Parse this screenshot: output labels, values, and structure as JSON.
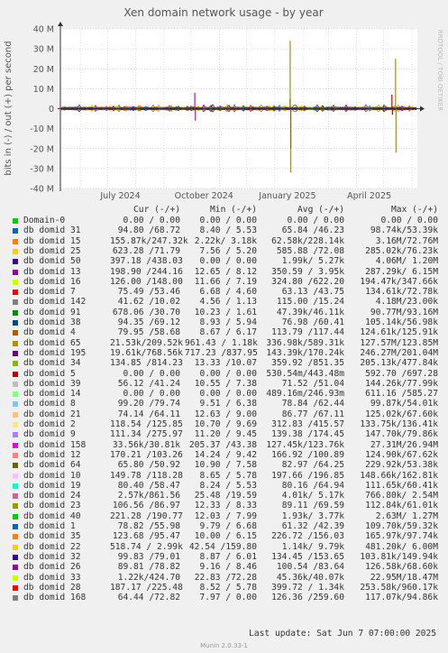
{
  "chart_data": {
    "type": "line",
    "title": "Xen domain network usage - by year",
    "ylabel": "bits in (-) / out (+) per second",
    "ylim": [
      -40000000,
      40000000
    ],
    "y_ticks": [
      "40 M",
      "30 M",
      "20 M",
      "10 M",
      "0",
      "-10 M",
      "-20 M",
      "-30 M",
      "-40 M"
    ],
    "x_ticks": [
      "July 2024",
      "October 2024",
      "January 2025",
      "April 2025"
    ],
    "side_label": "RRDTOOL / TOBI OETIKER",
    "grid": true,
    "spikes": [
      {
        "date": "2024-10-05",
        "out": 8000000,
        "in": -6000000,
        "color": "#cc00cc"
      },
      {
        "date": "2025-01-18",
        "out": 34000000,
        "in": -32000000,
        "color": "#b08c00"
      },
      {
        "date": "2025-01-18",
        "out": 5000000,
        "in": -20000000,
        "color": "#7d6c00"
      },
      {
        "date": "2025-05-14",
        "out": 25000000,
        "in": -22000000,
        "color": "#b08c00"
      },
      {
        "date": "2025-05-10",
        "out": 7000000,
        "in": -3000000,
        "color": "#cc0000"
      }
    ]
  },
  "legend": {
    "headers": {
      "cur": "Cur (-/+)",
      "min": "Min (-/+)",
      "avg": "Avg (-/+)",
      "max": "Max (-/+)"
    },
    "rows": [
      {
        "name": "Domain-0",
        "color": "#00cc00",
        "cur": "0.00 / 0.00",
        "min": "0.00 / 0.00",
        "avg": "0.00 / 0.00",
        "max": "0.00 / 0.00"
      },
      {
        "name": "db domid 31",
        "color": "#0066b3",
        "cur": "94.80 /68.72",
        "min": "8.40 / 5.53",
        "avg": "65.84 /46.23",
        "max": "98.74k/53.39k"
      },
      {
        "name": "db domid 15",
        "color": "#ff8000",
        "cur": "155.87k/247.32k",
        "min": "2.22k/ 3.18k",
        "avg": "62.58k/228.14k",
        "max": "3.16M/72.76M"
      },
      {
        "name": "db domid 25",
        "color": "#ffcc00",
        "cur": "623.28 /71.79",
        "min": "7.56 / 5.20",
        "avg": "585.88 /72.08",
        "max": "285.02k/76.23k"
      },
      {
        "name": "db domid 50",
        "color": "#330099",
        "cur": "397.18 /438.03",
        "min": "0.00 / 0.00",
        "avg": "1.99k/ 5.27k",
        "max": "4.06M/ 1.20M"
      },
      {
        "name": "db domid 13",
        "color": "#990099",
        "cur": "198.90 /244.16",
        "min": "12.65 / 8.12",
        "avg": "350.59 / 3.95k",
        "max": "287.29k/ 6.15M"
      },
      {
        "name": "db domid 16",
        "color": "#ccff00",
        "cur": "126.00 /148.00",
        "min": "11.66 / 7.19",
        "avg": "324.80 /622.20",
        "max": "194.47k/347.66k"
      },
      {
        "name": "db domid 7",
        "color": "#ff0000",
        "cur": "75.49 /53.46",
        "min": "6.68 / 4.60",
        "avg": "63.13 /43.75",
        "max": "134.61k/72.78k"
      },
      {
        "name": "db domid 142",
        "color": "#808080",
        "cur": "41.62 /10.02",
        "min": "4.56 / 1.13",
        "avg": "115.00 /15.24",
        "max": "4.18M/23.00k"
      },
      {
        "name": "db domid 91",
        "color": "#008f00",
        "cur": "678.06 /30.70",
        "min": "10.23 / 1.61",
        "avg": "47.39k/46.11k",
        "max": "90.77M/93.16M"
      },
      {
        "name": "db domid 38",
        "color": "#00487d",
        "cur": "94.35 /69.12",
        "min": "8.93 / 5.94",
        "avg": "76.98 /60.41",
        "max": "105.14k/56.98k"
      },
      {
        "name": "db domid 4",
        "color": "#b35a00",
        "cur": "79.95 /58.68",
        "min": "8.67 / 6.17",
        "avg": "113.79 /117.44",
        "max": "124.61k/125.91k"
      },
      {
        "name": "db domid 65",
        "color": "#b38f00",
        "cur": "21.53k/209.52k",
        "min": "961.43 / 1.18k",
        "avg": "336.98k/589.31k",
        "max": "127.57M/123.85M"
      },
      {
        "name": "db domid 195",
        "color": "#6b006b",
        "cur": "19.61k/768.56k",
        "min": "717.23 /837.95",
        "avg": "143.39k/170.24k",
        "max": "246.27M/201.04M"
      },
      {
        "name": "db domid 34",
        "color": "#8fb300",
        "cur": "134.85 /814.23",
        "min": "13.33 /10.07",
        "avg": "359.92 /851.35",
        "max": "205.13k/477.84k"
      },
      {
        "name": "db domid 5",
        "color": "#b30000",
        "cur": "0.00 / 0.00",
        "min": "0.00 / 0.00",
        "avg": "530.54m/443.48m",
        "max": "592.70 /697.28"
      },
      {
        "name": "db domid 39",
        "color": "#bebebe",
        "cur": "56.12 /41.24",
        "min": "10.55 / 7.38",
        "avg": "71.52 /51.04",
        "max": "144.26k/77.99k"
      },
      {
        "name": "db domid 14",
        "color": "#80ff80",
        "cur": "0.00 / 0.00",
        "min": "0.00 / 0.00",
        "avg": "489.16m/246.93m",
        "max": "611.16 /585.27"
      },
      {
        "name": "db domid 8",
        "color": "#80c9ff",
        "cur": "99.20 /79.74",
        "min": "9.51 / 6.38",
        "avg": "78.84 /62.44",
        "max": "99.87k/54.01k"
      },
      {
        "name": "db domid 21",
        "color": "#ffc080",
        "cur": "74.14 /64.11",
        "min": "12.63 / 9.00",
        "avg": "86.77 /67.11",
        "max": "125.02k/67.60k"
      },
      {
        "name": "db domid 2",
        "color": "#ffe680",
        "cur": "118.54 /125.85",
        "min": "10.70 / 9.69",
        "avg": "312.83 /415.57",
        "max": "133.75k/136.41k"
      },
      {
        "name": "db domid 9",
        "color": "#aa80ff",
        "cur": "111.34 /275.97",
        "min": "11.20 / 9.45",
        "avg": "139.38 /174.45",
        "max": "147.70k/79.86k"
      },
      {
        "name": "db domid 158",
        "color": "#ee00cc",
        "cur": "33.56k/30.81k",
        "min": "205.37 /43.38",
        "avg": "127.45k/123.76k",
        "max": "27.31M/26.94M"
      },
      {
        "name": "db domid 12",
        "color": "#ff8080",
        "cur": "170.21 /103.26",
        "min": "14.24 / 9.42",
        "avg": "166.92 /100.89",
        "max": "124.90k/67.62k"
      },
      {
        "name": "db domid 64",
        "color": "#666600",
        "cur": "65.80 /50.92",
        "min": "10.90 / 7.58",
        "avg": "82.97 /64.25",
        "max": "229.92k/53.38k"
      },
      {
        "name": "db domid 10",
        "color": "#ffbfff",
        "cur": "149.78 /118.28",
        "min": "8.65 / 5.78",
        "avg": "197.66 /196.85",
        "max": "148.66k/162.81k"
      },
      {
        "name": "db domid 19",
        "color": "#00ffcc",
        "cur": "80.40 /58.47",
        "min": "8.24 / 5.53",
        "avg": "80.16 /64.94",
        "max": "111.65k/60.41k"
      },
      {
        "name": "db domid 24",
        "color": "#cc6699",
        "cur": "2.57k/861.56",
        "min": "25.48 /19.59",
        "avg": "4.01k/ 5.17k",
        "max": "766.80k/ 2.54M"
      },
      {
        "name": "db domid 23",
        "color": "#999900",
        "cur": "106.56 /86.97",
        "min": "12.33 / 8.33",
        "avg": "89.11 /69.59",
        "max": "112.84k/61.01k"
      },
      {
        "name": "db domid 40",
        "color": "#00cc00",
        "cur": "221.28 /190.77",
        "min": "12.03 / 7.99",
        "avg": "1.93k/ 3.77k",
        "max": "2.63M/ 1.27M"
      },
      {
        "name": "db domid 1",
        "color": "#0066b3",
        "cur": "78.82 /55.98",
        "min": "9.79 / 6.68",
        "avg": "61.32 /42.39",
        "max": "109.70k/59.32k"
      },
      {
        "name": "db domid 35",
        "color": "#ff8000",
        "cur": "123.68 /95.47",
        "min": "10.00 / 6.15",
        "avg": "226.72 /156.03",
        "max": "165.97k/97.74k"
      },
      {
        "name": "db domid 22",
        "color": "#ffcc00",
        "cur": "518.74 / 2.99k",
        "min": "42.54 /159.80",
        "avg": "1.14k/ 9.79k",
        "max": "481.20k/ 6.00M"
      },
      {
        "name": "db domid 32",
        "color": "#330099",
        "cur": "99.83 /79.01",
        "min": "8.87 / 6.01",
        "avg": "134.45 /153.65",
        "max": "103.81k/149.94k"
      },
      {
        "name": "db domid 26",
        "color": "#990099",
        "cur": "89.81 /78.82",
        "min": "9.16 / 8.46",
        "avg": "100.54 /83.64",
        "max": "126.58k/68.60k"
      },
      {
        "name": "db domid 33",
        "color": "#ccff00",
        "cur": "1.22k/424.70",
        "min": "22.83 /72.28",
        "avg": "45.36k/40.07k",
        "max": "22.95M/18.47M"
      },
      {
        "name": "db domid 28",
        "color": "#ff0000",
        "cur": "187.17 /225.48",
        "min": "8.52 / 5.78",
        "avg": "399.72 / 1.34k",
        "max": "253.58k/960.17k"
      },
      {
        "name": "db domid 168",
        "color": "#808080",
        "cur": "64.44 /72.82",
        "min": "7.97 / 0.00",
        "avg": "126.36 /259.60",
        "max": "117.07k/94.86k"
      }
    ]
  },
  "footer": {
    "last_update": "Last update:  Sat Jun  7 07:00:00 2025",
    "generator": "Munin 2.0.33-1"
  }
}
